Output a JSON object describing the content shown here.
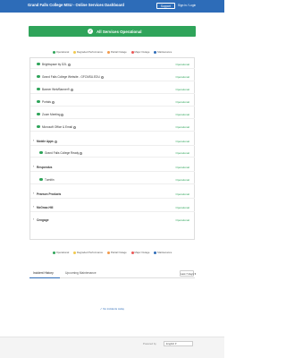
{
  "header": {
    "title": "Grand Falls College MSU - Online Services Dashboard",
    "support_label": "Support",
    "signin_label": "Sign in / Login"
  },
  "banner": {
    "text": "All Services Operational",
    "color": "#2fa45a"
  },
  "legend": [
    {
      "label": "Operational",
      "color": "#2fa45a"
    },
    {
      "label": "Degraded Performance",
      "color": "#f2c94c"
    },
    {
      "label": "Partial Outage",
      "color": "#f2994a"
    },
    {
      "label": "Major Outage",
      "color": "#eb5757"
    },
    {
      "label": "Maintenance",
      "color": "#2d6cb8"
    }
  ],
  "services": [
    {
      "name": "Brightspace by D2L",
      "status": "Operational",
      "has_info": true
    },
    {
      "name": "Grand Falls College Website - GFCMSU.EDU",
      "status": "Operational",
      "has_info": true
    },
    {
      "name": "Banner Web/Banner9",
      "status": "Operational",
      "has_info": true
    },
    {
      "name": "Portals",
      "status": "Operational",
      "has_info": true
    },
    {
      "name": "Zoom Meeting",
      "status": "Operational",
      "has_info": true
    },
    {
      "name": "Microsoft Office & Email",
      "status": "Operational",
      "has_info": true
    },
    {
      "name": "Mobile Apps",
      "status": "Operational",
      "has_info": true
    },
    {
      "name": "Grand Falls College Ready",
      "status": "Operational",
      "has_info": true
    },
    {
      "name": "Respondus",
      "status": "Operational",
      "has_info": false
    },
    {
      "name": "Turnitin",
      "status": "Operational",
      "has_info": false
    },
    {
      "name": "Pearson Products",
      "status": "Operational",
      "has_info": false
    },
    {
      "name": "McGraw-Hill",
      "status": "Operational",
      "has_info": false
    },
    {
      "name": "Cengage",
      "status": "Operational",
      "has_info": false
    }
  ],
  "tabs": {
    "incident_history": "Incident History",
    "upcoming_maintenance": "Upcoming Maintenance",
    "range": "Last 7 days"
  },
  "no_events": "No incidents today",
  "footer": {
    "powered_by": "Powered by",
    "language": "English"
  }
}
